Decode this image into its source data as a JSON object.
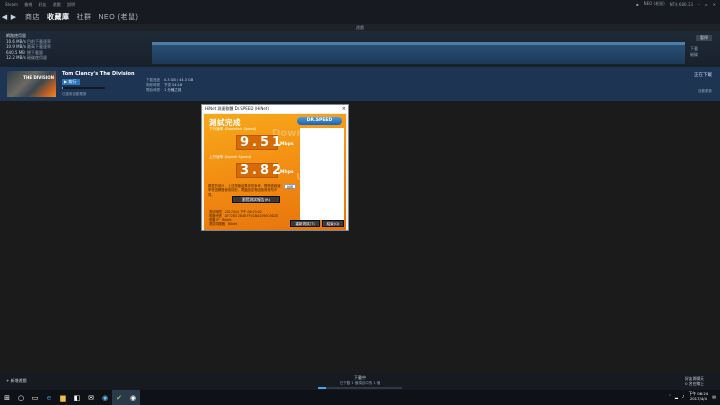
{
  "sysbar": {
    "menus": [
      "Steam",
      "檢視",
      "好友",
      "遊戲",
      "說明"
    ],
    "user": "NEO (老鼠)",
    "wallet": "NT$ 680.13"
  },
  "nav": {
    "back": "◀",
    "forward": "▶",
    "items": [
      "商店",
      "收藏庫",
      "社群",
      "NEO (老鼠)"
    ]
  },
  "subbar": {
    "label": "遊戲"
  },
  "dlpanel": {
    "heading": "網路使用量",
    "stats": [
      {
        "value": "10.6 MB/s",
        "label": "目前下載速率"
      },
      {
        "value": "10.9 MB/s",
        "label": "最高下載速率"
      },
      {
        "value": "640.5 MB",
        "label": "總下載量"
      },
      {
        "value": "12.2 MB/s",
        "label": "磁碟使用量"
      }
    ],
    "pause_label": "暫停",
    "legend": [
      "下載",
      "磁碟"
    ]
  },
  "game": {
    "cover_text": "THE DIVISION",
    "title": "Tom Clancy's The Division",
    "play_label": "▶ 執行",
    "progress": 0.03,
    "sub": "已啟用自動更新",
    "meta": [
      {
        "label": "下載進度",
        "value": "0.3 GB / 44.3 GB"
      },
      {
        "label": "剩餘時間",
        "value": "下次 04:16"
      },
      {
        "label": "開始時間",
        "value": "1 分鐘之前"
      }
    ],
    "right_label": "正在下載",
    "right_sub": "自動更新"
  },
  "dialog": {
    "title": "HiNet 測速軟體 Dr.SPEED (HiNet)",
    "close": "×",
    "done": "測試完成",
    "logo": "DR.SPEED",
    "watermark1": "Downl",
    "watermark2": "Up",
    "down_label": "下行速率 (Downlink Speed)",
    "down_value": "9.51",
    "down_unit": "Mbps",
    "up_label": "上行速率 (Uplink Speed)",
    "up_value": "3.82",
    "up_unit": "Mbps",
    "note": "親愛的用戶，上述測速結果僅供參考，實際連線速率會因網路使用情形、電腦設定等因素而有所不同。",
    "note_button": "說明",
    "report_button": "瀏覽測試報告(R)",
    "info": [
      {
        "label": "測試時間",
        "value": "2017/0/4 下午 06:23:02"
      },
      {
        "label": "電腦代號",
        "value": "AF7283 2848 FF4CBA1090C9D2E"
      },
      {
        "label": "電腦 IP",
        "value": "Bibiet"
      },
      {
        "label": "測試伺服器",
        "value": "Bibiet"
      }
    ],
    "retest_button": "重新測試(T)",
    "close_button": "結束(Q)"
  },
  "bottom": {
    "add_game": "+ 新增遊戲",
    "dl_title": "下載中",
    "dl_sub": "已下載 1 個項目中的 1 個",
    "dl_progress": 0.1,
    "friends": "好友與聊天",
    "friends_sub": "0 名在線上"
  },
  "taskbar": {
    "icons": [
      "windows-icon",
      "search-icon",
      "task-view-icon",
      "edge-icon",
      "explorer-icon",
      "store-icon",
      "mail-icon",
      "steam-icon",
      "check-icon",
      "steam-client-icon"
    ],
    "time": "下午 06:24",
    "date": "2017/4/4"
  }
}
